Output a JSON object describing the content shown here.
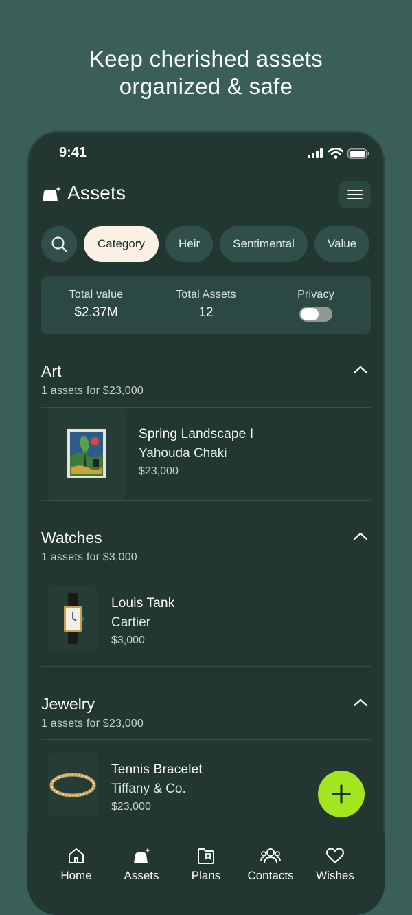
{
  "headline": {
    "line1": "Keep cherished assets",
    "line2": "organized & safe"
  },
  "status_bar": {
    "time": "9:41"
  },
  "header": {
    "title": "Assets"
  },
  "filters": [
    "Category",
    "Heir",
    "Sentimental",
    "Value"
  ],
  "active_filter": "Category",
  "summary": {
    "total_value_label": "Total value",
    "total_value": "$2.37M",
    "total_assets_label": "Total Assets",
    "total_assets": "12",
    "privacy_label": "Privacy",
    "privacy_on": false
  },
  "sections": [
    {
      "title": "Art",
      "subtitle": "1 assets for $23,000",
      "asset": {
        "name": "Spring Landscape I",
        "maker": "Yahouda Chaki",
        "price": "$23,000"
      }
    },
    {
      "title": "Watches",
      "subtitle": "1 assets for $3,000",
      "asset": {
        "name": "Louis Tank",
        "maker": "Cartier",
        "price": "$3,000"
      }
    },
    {
      "title": "Jewelry",
      "subtitle": "1 assets for $23,000",
      "asset": {
        "name": "Tennis Bracelet",
        "maker": "Tiffany & Co.",
        "price": "$23,000"
      }
    }
  ],
  "tabs": [
    {
      "label": "Home",
      "icon": "home-icon"
    },
    {
      "label": "Assets",
      "icon": "assets-icon"
    },
    {
      "label": "Plans",
      "icon": "plans-icon"
    },
    {
      "label": "Contacts",
      "icon": "contacts-icon"
    },
    {
      "label": "Wishes",
      "icon": "heart-icon"
    }
  ],
  "colors": {
    "background": "#3a5f57",
    "phone": "#223731",
    "fab": "#a3e51f",
    "active_chip": "#fbf0e4"
  }
}
